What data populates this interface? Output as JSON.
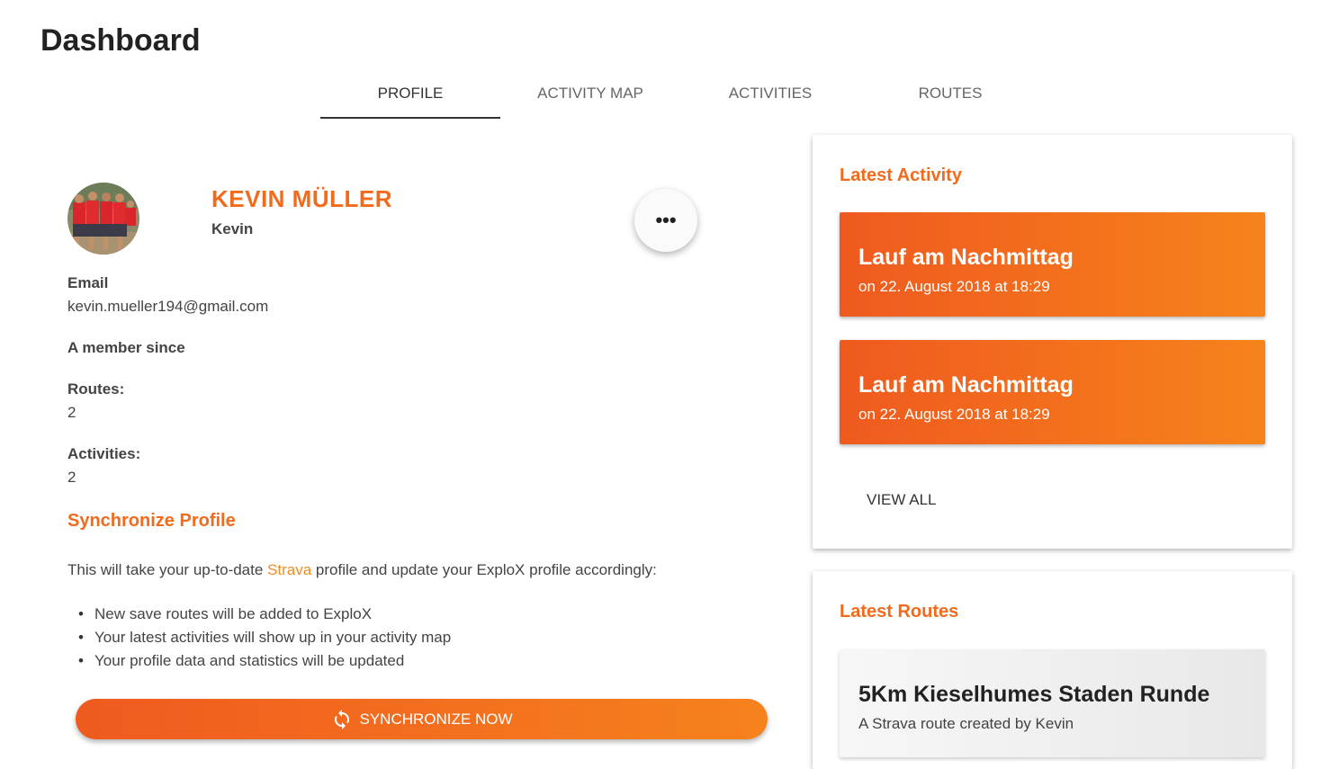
{
  "page": {
    "title": "Dashboard"
  },
  "tabs": [
    {
      "label": "PROFILE",
      "active": true
    },
    {
      "label": "ACTIVITY MAP",
      "active": false
    },
    {
      "label": "ACTIVITIES",
      "active": false
    },
    {
      "label": "ROUTES",
      "active": false
    }
  ],
  "profile": {
    "name": "KEVIN MÜLLER",
    "username": "Kevin",
    "more_icon": "more-horizontal-icon",
    "email_label": "Email",
    "email_value": "kevin.mueller194@gmail.com",
    "member_since_label": "A member since",
    "routes_label": "Routes:",
    "routes_value": "2",
    "activities_label": "Activities:",
    "activities_value": "2"
  },
  "sync": {
    "title": "Synchronize Profile",
    "desc_before": "This will take your up-to-date ",
    "desc_link": "Strava",
    "desc_after": " profile and update your ExploX profile accordingly:",
    "bullets": [
      "New save routes will be added to ExploX",
      "Your latest activities will show up in your activity map",
      "Your profile data and statistics will be updated"
    ],
    "button_label": "SYNCHRONIZE NOW",
    "button_icon": "sync-icon"
  },
  "latest_activity": {
    "title": "Latest Activity",
    "items": [
      {
        "title": "Lauf am Nachmittag",
        "date": "on 22. August 2018 at 18:29"
      },
      {
        "title": "Lauf am Nachmittag",
        "date": "on 22. August 2018 at 18:29"
      }
    ],
    "view_all_label": "VIEW ALL"
  },
  "latest_routes": {
    "title": "Latest Routes",
    "items": [
      {
        "title": "5Km Kieselhumes Staden Runde",
        "subtitle": "A Strava route created by Kevin"
      }
    ]
  },
  "colors": {
    "accent": "#f26b1d",
    "gradient_start": "#ef5a1f",
    "gradient_end": "#f6831b"
  }
}
